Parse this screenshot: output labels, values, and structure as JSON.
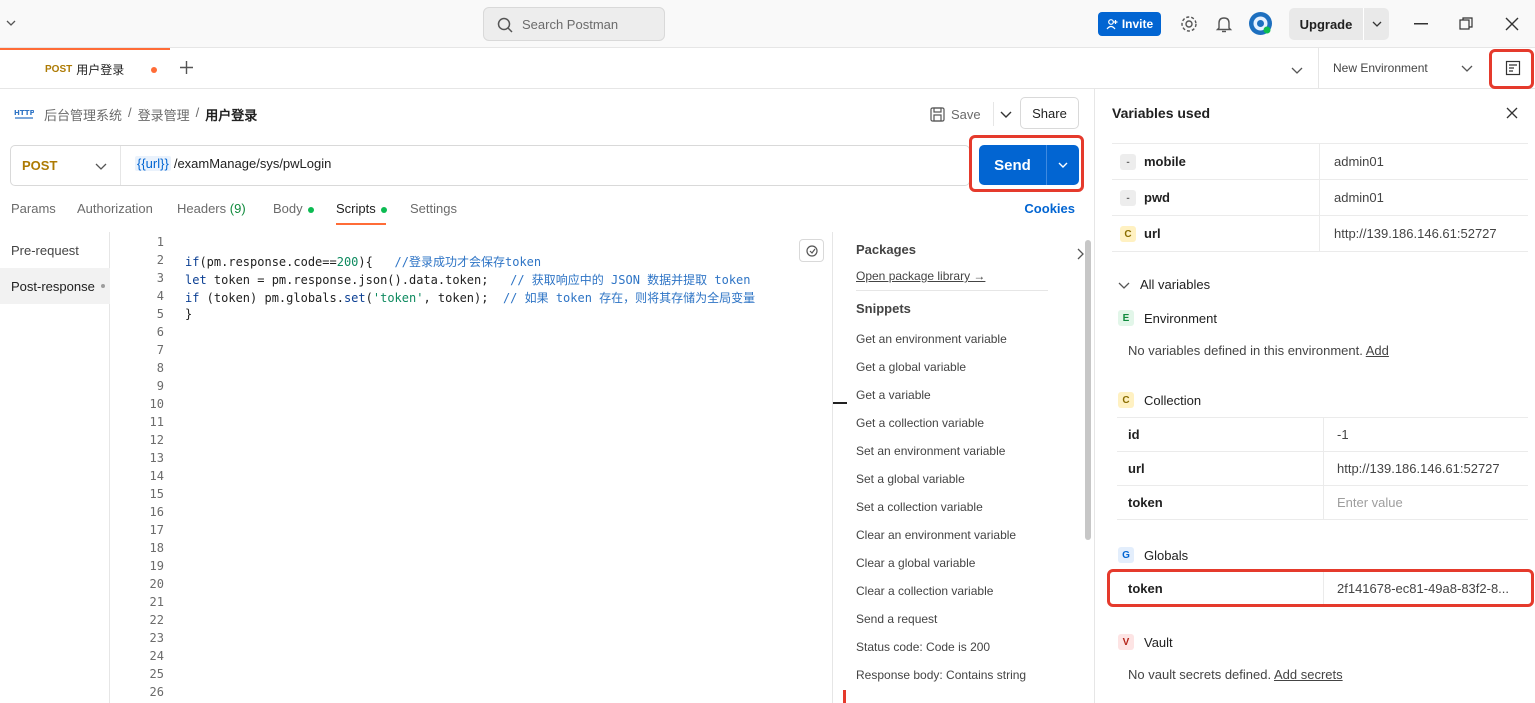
{
  "titlebar": {
    "search_placeholder": "Search Postman",
    "invite_label": "Invite",
    "upgrade_label": "Upgrade"
  },
  "tab": {
    "method": "POST",
    "name": "用户登录"
  },
  "environment": {
    "selected": "New Environment"
  },
  "breadcrumb": {
    "items": [
      "后台管理系统",
      "/",
      "登录管理",
      "/",
      "用户登录"
    ]
  },
  "actions": {
    "save_label": "Save",
    "share_label": "Share",
    "send_label": "Send"
  },
  "request": {
    "method": "POST",
    "url_var": "{{url}}",
    "url_path": "/examManage/sys/pwLogin"
  },
  "request_tabs": [
    {
      "label": "Params"
    },
    {
      "label": "Authorization"
    },
    {
      "label": "Headers",
      "count": "(9)"
    },
    {
      "label": "Body"
    },
    {
      "label": "Scripts"
    },
    {
      "label": "Settings"
    }
  ],
  "cookies_label": "Cookies",
  "script_side": {
    "pre_request": "Pre-request",
    "post_response": "Post-response"
  },
  "code_lines": [
    "if(pm.response.code==200){   //登录成功才会保存token",
    "let token = pm.response.json().data.token;   // 获取响应中的 JSON 数据并提取 token",
    "if (token) pm.globals.set('token', token);  // 如果 token 存在，则将其存储为全局变量",
    "}"
  ],
  "line_numbers": [
    "1",
    "2",
    "3",
    "4",
    "5",
    "6",
    "7",
    "8",
    "9",
    "10",
    "11",
    "12",
    "13",
    "14",
    "15",
    "16",
    "17",
    "18",
    "19",
    "20",
    "21",
    "22",
    "23",
    "24",
    "25",
    "26"
  ],
  "snippets": {
    "packages_title": "Packages",
    "package_link": "Open package library →",
    "title": "Snippets",
    "items": [
      "Get an environment variable",
      "Get a global variable",
      "Get a variable",
      "Get a collection variable",
      "Set an environment variable",
      "Set a global variable",
      "Set a collection variable",
      "Clear an environment variable",
      "Clear a global variable",
      "Clear a collection variable",
      "Send a request",
      "Status code: Code is 200",
      "Response body: Contains string"
    ]
  },
  "vars_panel": {
    "title": "Variables used",
    "used": [
      {
        "badge": "-",
        "name": "mobile",
        "value": "admin01"
      },
      {
        "badge": "-",
        "name": "pwd",
        "value": "admin01"
      },
      {
        "badge": "C",
        "name": "url",
        "value": "http://139.186.146.61:52727"
      }
    ],
    "all_variables": "All variables",
    "environment": {
      "badge": "E",
      "label": "Environment",
      "note": "No variables defined in this environment.",
      "add": "Add"
    },
    "collection": {
      "badge": "C",
      "label": "Collection",
      "rows": [
        {
          "name": "id",
          "value": "-1"
        },
        {
          "name": "url",
          "value": "http://139.186.146.61:52727"
        },
        {
          "name": "token",
          "value": "",
          "placeholder": "Enter value"
        }
      ]
    },
    "globals": {
      "badge": "G",
      "label": "Globals",
      "rows": [
        {
          "name": "token",
          "value": "2f141678-ec81-49a8-83f2-8..."
        }
      ]
    },
    "vault": {
      "badge": "V",
      "label": "Vault",
      "note": "No vault secrets defined.",
      "add": "Add secrets"
    }
  },
  "colors": {
    "brand": "#ff6c37",
    "primary": "#0265d2",
    "highlight": "#e53a2c"
  }
}
